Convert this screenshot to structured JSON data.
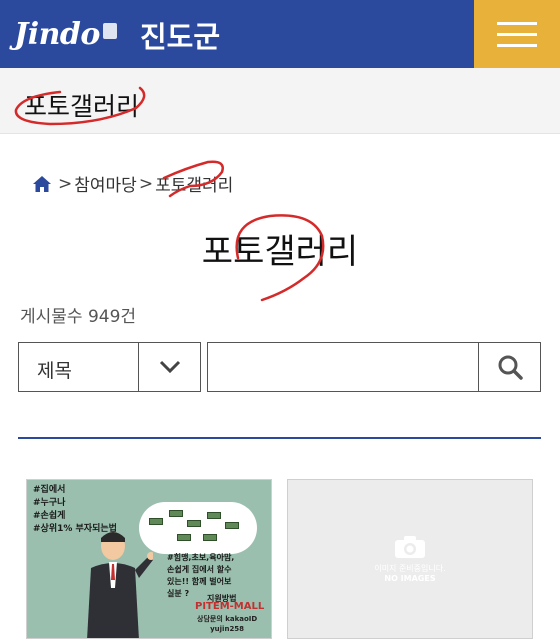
{
  "header": {
    "logo_text": "Jindo",
    "county_name": "진도군",
    "menu_icon": "hamburger-menu-icon",
    "bg_color": "#2b4a9e",
    "menu_color": "#e8b23a"
  },
  "section": {
    "title": "포토갤러리"
  },
  "breadcrumb": {
    "home_icon": "home-icon",
    "items": [
      "참여마당",
      "포토갤러리"
    ],
    "separator": ">"
  },
  "page": {
    "title": "포토갤러리",
    "post_count": "게시물수 949건"
  },
  "search": {
    "field_selected": "제목",
    "query_value": "",
    "search_icon": "search-icon"
  },
  "gallery": {
    "items": [
      {
        "lines_left": [
          "#집에서",
          "#누구나",
          "#손쉽게",
          "#상위1% 부자되는법"
        ],
        "lines_right": [
          "#힘맹,초보,육아맘,",
          "손쉽게 집에서 할수",
          "있는!! 함께 벌어보",
          "실분 ?"
        ],
        "support_label": "지원방법",
        "brand": "PITEM-MALL",
        "contact_line1": "상담문의 kakaoID",
        "contact_line2": "yujin258"
      },
      {
        "placeholder_text": "이미지 준비중입니다.",
        "placeholder_en": "NO IMAGES",
        "icon": "camera-icon"
      }
    ]
  }
}
